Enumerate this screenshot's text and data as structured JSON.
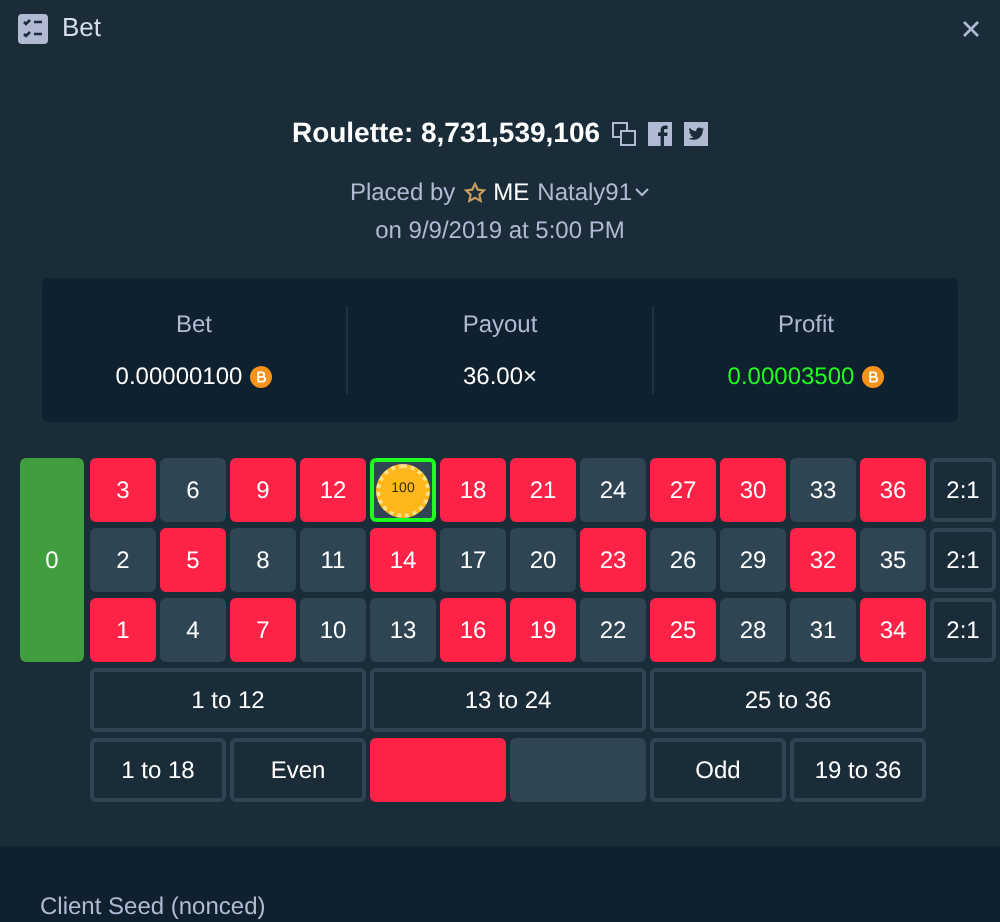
{
  "window": {
    "title": "Bet"
  },
  "heading": {
    "title": "Roulette: 8,731,539,106"
  },
  "placed": {
    "prefix": "Placed by",
    "rank": "ME",
    "user": "Nataly91",
    "date": "on 9/9/2019 at 5:00 PM"
  },
  "stats": [
    {
      "label": "Bet",
      "value": "0.00000100",
      "kind": "coin"
    },
    {
      "label": "Payout",
      "value": "36.00×",
      "kind": "plain"
    },
    {
      "label": "Profit",
      "value": "0.00003500",
      "kind": "profit"
    }
  ],
  "zero": "0",
  "rows": [
    [
      {
        "label": "3",
        "kind": "red"
      },
      {
        "label": "6",
        "kind": "black"
      },
      {
        "label": "9",
        "kind": "red"
      },
      {
        "label": "12",
        "kind": "red"
      },
      {
        "chip": "100",
        "kind": "black"
      },
      {
        "label": "18",
        "kind": "red"
      },
      {
        "label": "21",
        "kind": "red"
      },
      {
        "label": "24",
        "kind": "black"
      },
      {
        "label": "27",
        "kind": "red"
      },
      {
        "label": "30",
        "kind": "red"
      },
      {
        "label": "33",
        "kind": "black"
      },
      {
        "label": "36",
        "kind": "red"
      },
      {
        "label": "2:1",
        "kind": "column"
      }
    ],
    [
      {
        "label": "2",
        "kind": "black"
      },
      {
        "label": "5",
        "kind": "red"
      },
      {
        "label": "8",
        "kind": "black"
      },
      {
        "label": "11",
        "kind": "black"
      },
      {
        "label": "14",
        "kind": "red"
      },
      {
        "label": "17",
        "kind": "black"
      },
      {
        "label": "20",
        "kind": "black"
      },
      {
        "label": "23",
        "kind": "red"
      },
      {
        "label": "26",
        "kind": "black"
      },
      {
        "label": "29",
        "kind": "black"
      },
      {
        "label": "32",
        "kind": "red"
      },
      {
        "label": "35",
        "kind": "black"
      },
      {
        "label": "2:1",
        "kind": "column"
      }
    ],
    [
      {
        "label": "1",
        "kind": "red"
      },
      {
        "label": "4",
        "kind": "black"
      },
      {
        "label": "7",
        "kind": "red"
      },
      {
        "label": "10",
        "kind": "black"
      },
      {
        "label": "13",
        "kind": "black"
      },
      {
        "label": "16",
        "kind": "red"
      },
      {
        "label": "19",
        "kind": "red"
      },
      {
        "label": "22",
        "kind": "black"
      },
      {
        "label": "25",
        "kind": "red"
      },
      {
        "label": "28",
        "kind": "black"
      },
      {
        "label": "31",
        "kind": "black"
      },
      {
        "label": "34",
        "kind": "red"
      },
      {
        "label": "2:1",
        "kind": "column"
      }
    ]
  ],
  "dozens": [
    "1 to 12",
    "13 to 24",
    "25 to 36"
  ],
  "outside": [
    {
      "label": "1 to 18",
      "kind": "plain"
    },
    {
      "label": "Even",
      "kind": "plain"
    },
    {
      "kind": "red"
    },
    {
      "kind": "black"
    },
    {
      "label": "Odd",
      "kind": "plain"
    },
    {
      "label": "19 to 36",
      "kind": "plain"
    }
  ],
  "footer": {
    "label": "Client Seed (nonced)"
  }
}
